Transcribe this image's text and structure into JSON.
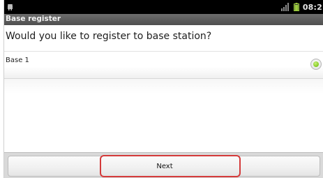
{
  "status_bar": {
    "left_icon": "android-icon",
    "signal_icon": "signal-icon",
    "battery_icon": "battery-icon",
    "time": "08:2"
  },
  "title_bar": {
    "title": "Base register"
  },
  "dialog": {
    "prompt": "Would you like to register to base station?",
    "options": [
      {
        "label": "Base 1",
        "selected": true
      }
    ]
  },
  "footer": {
    "next_label": "Next"
  },
  "colors": {
    "status_bar_bg": "#000000",
    "title_bar_bg": "#5a5a5a",
    "radio_selected": "#8ccf2c",
    "highlight_border": "#d43a3a"
  }
}
